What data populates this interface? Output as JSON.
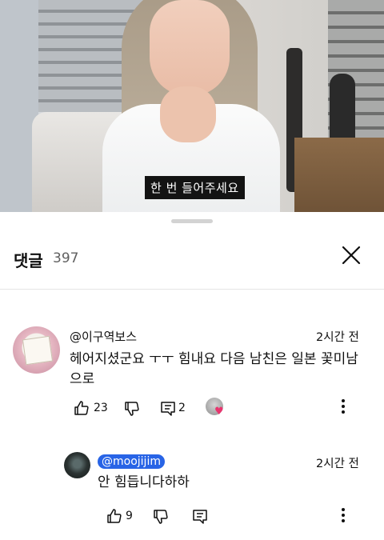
{
  "video": {
    "caption": "한 번 들어주세요"
  },
  "comments_sheet": {
    "title": "댓글",
    "count": "397"
  },
  "comments": [
    {
      "author": "@이구역보스",
      "time": "2시간 전",
      "text_line1": "헤어지셨군요 ㅜㅜ 힘내요 다음 남친은 일본 꽃미남",
      "text_line2": "으로",
      "likes": "23",
      "replies": "2"
    }
  ],
  "reply": {
    "author": "@moojijim",
    "time": "2시간 전",
    "text": "안 힘듭니다하하",
    "likes": "9"
  },
  "icons": {
    "close": "close-icon",
    "like": "thumbs-up-icon",
    "dislike": "thumbs-down-icon",
    "reply": "reply-icon",
    "more": "more-vert-icon",
    "creator_heart": "creator-heart-icon"
  },
  "colors": {
    "mention_badge": "#2864e6",
    "heart": "#e8356e"
  }
}
